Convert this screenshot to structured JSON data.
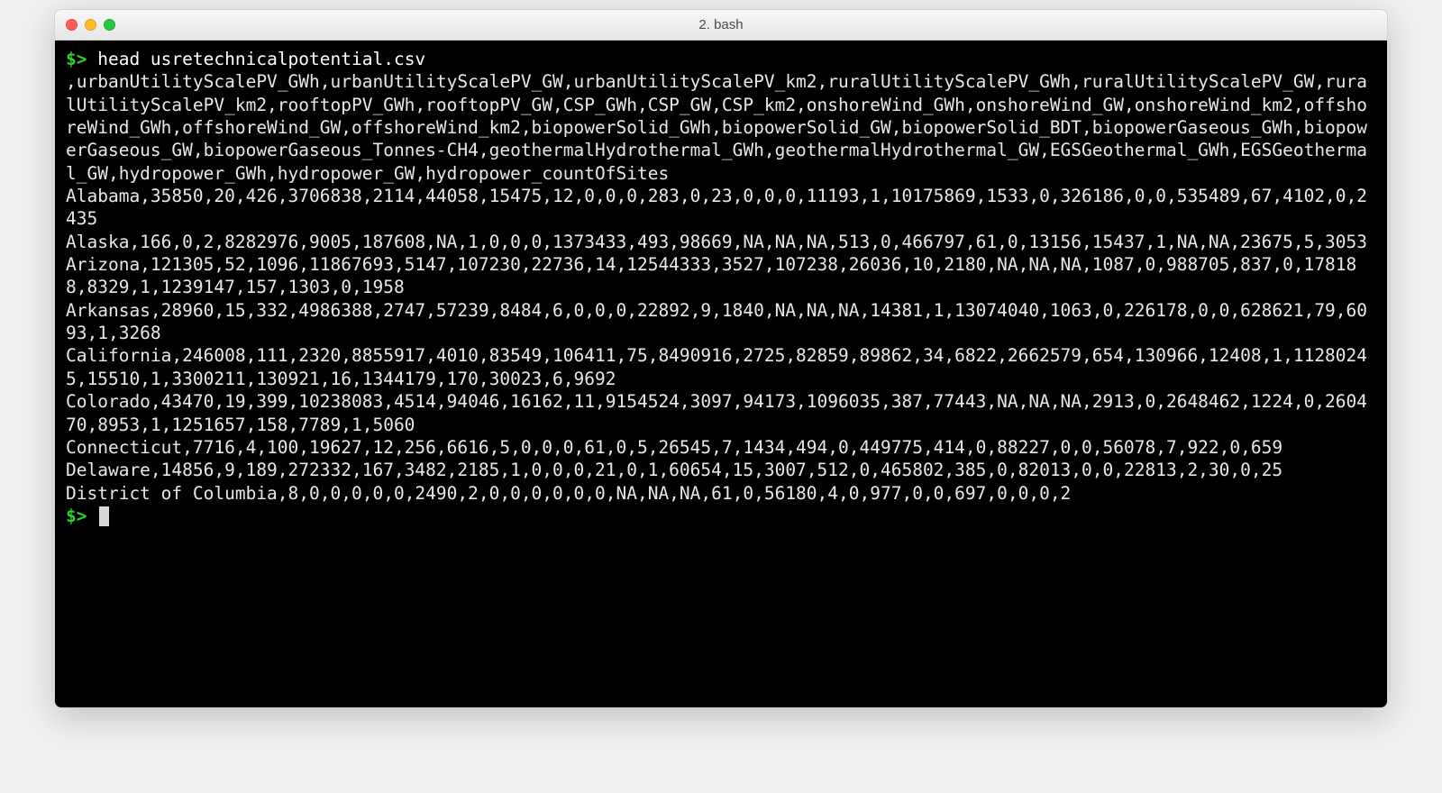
{
  "window": {
    "title": "2. bash"
  },
  "terminal": {
    "prompt": "$>",
    "command": "head usretechnicalpotential.csv",
    "output_lines": [
      ",urbanUtilityScalePV_GWh,urbanUtilityScalePV_GW,urbanUtilityScalePV_km2,ruralUtilityScalePV_GWh,ruralUtilityScalePV_GW,ruralUtilityScalePV_km2,rooftopPV_GWh,rooftopPV_GW,CSP_GWh,CSP_GW,CSP_km2,onshoreWind_GWh,onshoreWind_GW,onshoreWind_km2,offshoreWind_GWh,offshoreWind_GW,offshoreWind_km2,biopowerSolid_GWh,biopowerSolid_GW,biopowerSolid_BDT,biopowerGaseous_GWh,biopowerGaseous_GW,biopowerGaseous_Tonnes-CH4,geothermalHydrothermal_GWh,geothermalHydrothermal_GW,EGSGeothermal_GWh,EGSGeothermal_GW,hydropower_GWh,hydropower_GW,hydropower_countOfSites",
      "Alabama,35850,20,426,3706838,2114,44058,15475,12,0,0,0,283,0,23,0,0,0,11193,1,10175869,1533,0,326186,0,0,535489,67,4102,0,2435",
      "Alaska,166,0,2,8282976,9005,187608,NA,1,0,0,0,1373433,493,98669,NA,NA,NA,513,0,466797,61,0,13156,15437,1,NA,NA,23675,5,3053",
      "Arizona,121305,52,1096,11867693,5147,107230,22736,14,12544333,3527,107238,26036,10,2180,NA,NA,NA,1087,0,988705,837,0,178188,8329,1,1239147,157,1303,0,1958",
      "Arkansas,28960,15,332,4986388,2747,57239,8484,6,0,0,0,22892,9,1840,NA,NA,NA,14381,1,13074040,1063,0,226178,0,0,628621,79,6093,1,3268",
      "California,246008,111,2320,8855917,4010,83549,106411,75,8490916,2725,82859,89862,34,6822,2662579,654,130966,12408,1,11280245,15510,1,3300211,130921,16,1344179,170,30023,6,9692",
      "Colorado,43470,19,399,10238083,4514,94046,16162,11,9154524,3097,94173,1096035,387,77443,NA,NA,NA,2913,0,2648462,1224,0,260470,8953,1,1251657,158,7789,1,5060",
      "Connecticut,7716,4,100,19627,12,256,6616,5,0,0,0,61,0,5,26545,7,1434,494,0,449775,414,0,88227,0,0,56078,7,922,0,659",
      "Delaware,14856,9,189,272332,167,3482,2185,1,0,0,0,21,0,1,60654,15,3007,512,0,465802,385,0,82013,0,0,22813,2,30,0,25",
      "District of Columbia,8,0,0,0,0,0,2490,2,0,0,0,0,0,0,NA,NA,NA,61,0,56180,4,0,977,0,0,697,0,0,0,2"
    ]
  }
}
